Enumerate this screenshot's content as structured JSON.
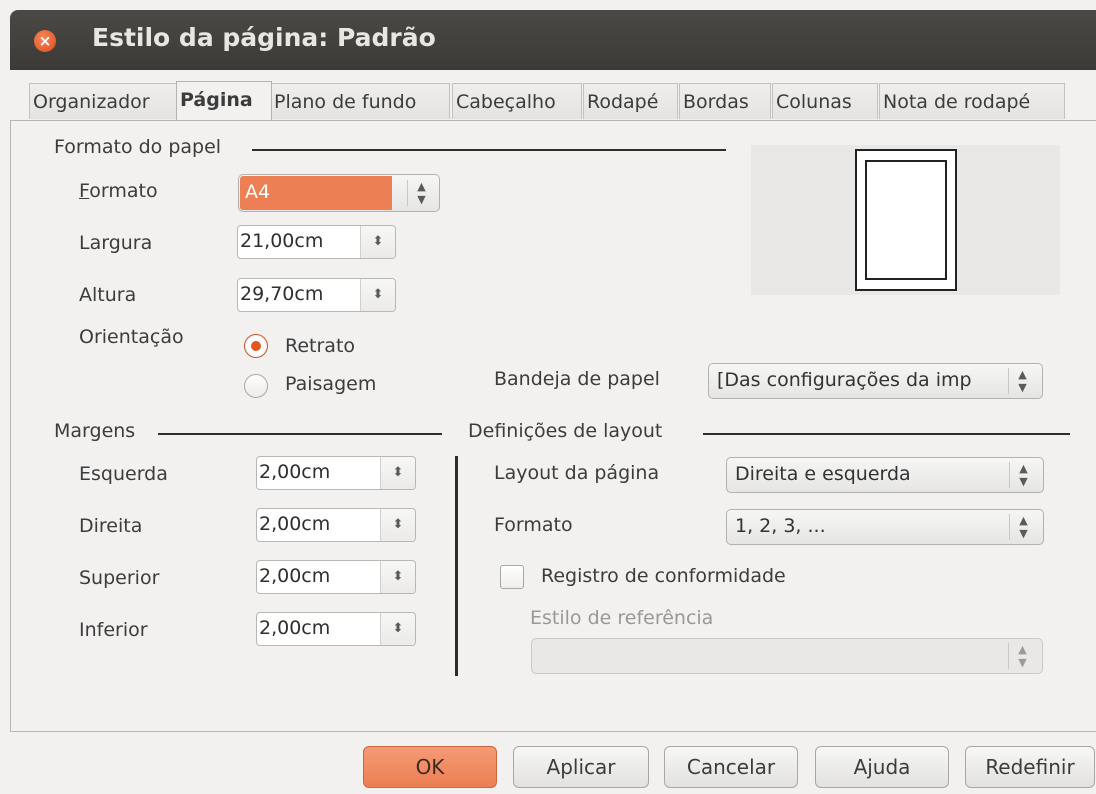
{
  "window": {
    "title": "Estilo da página: Padrão"
  },
  "tabs": [
    {
      "label": "Organizador"
    },
    {
      "label": "Página",
      "active": true
    },
    {
      "label": "Plano de fundo"
    },
    {
      "label": "Cabeçalho"
    },
    {
      "label": "Rodapé"
    },
    {
      "label": "Bordas"
    },
    {
      "label": "Colunas"
    },
    {
      "label": "Nota de rodapé"
    }
  ],
  "paper_format": {
    "section_title": "Formato do papel",
    "format_label": "Formato",
    "format_value": "A4",
    "width_label": "Largura",
    "width_value": "21,00cm",
    "height_label": "Altura",
    "height_value": "29,70cm",
    "orientation_label": "Orientação",
    "orientation_options": [
      "Retrato",
      "Paisagem"
    ],
    "orientation_selected": "Retrato",
    "paper_tray_label": "Bandeja de papel",
    "paper_tray_value": "[Das configurações da imp"
  },
  "margins": {
    "section_title": "Margens",
    "left_label": "Esquerda",
    "left_value": "2,00cm",
    "right_label": "Direita",
    "right_value": "2,00cm",
    "top_label": "Superior",
    "top_value": "2,00cm",
    "bottom_label": "Inferior",
    "bottom_value": "2,00cm"
  },
  "layout": {
    "section_title": "Definições de layout",
    "page_layout_label": "Layout da página",
    "page_layout_value": "Direita e esquerda",
    "format_label": "Formato",
    "format_value": "1, 2, 3, ...",
    "register_label": "Registro de conformidade",
    "register_checked": false,
    "reference_style_label": "Estilo de referência",
    "reference_style_value": ""
  },
  "buttons": {
    "ok": "OK",
    "apply": "Aplicar",
    "cancel": "Cancelar",
    "help": "Ajuda",
    "reset": "Redefinir"
  },
  "colors": {
    "accent": "#ec7f53",
    "titlebar": "#3c3b37",
    "close": "#e2561f"
  }
}
